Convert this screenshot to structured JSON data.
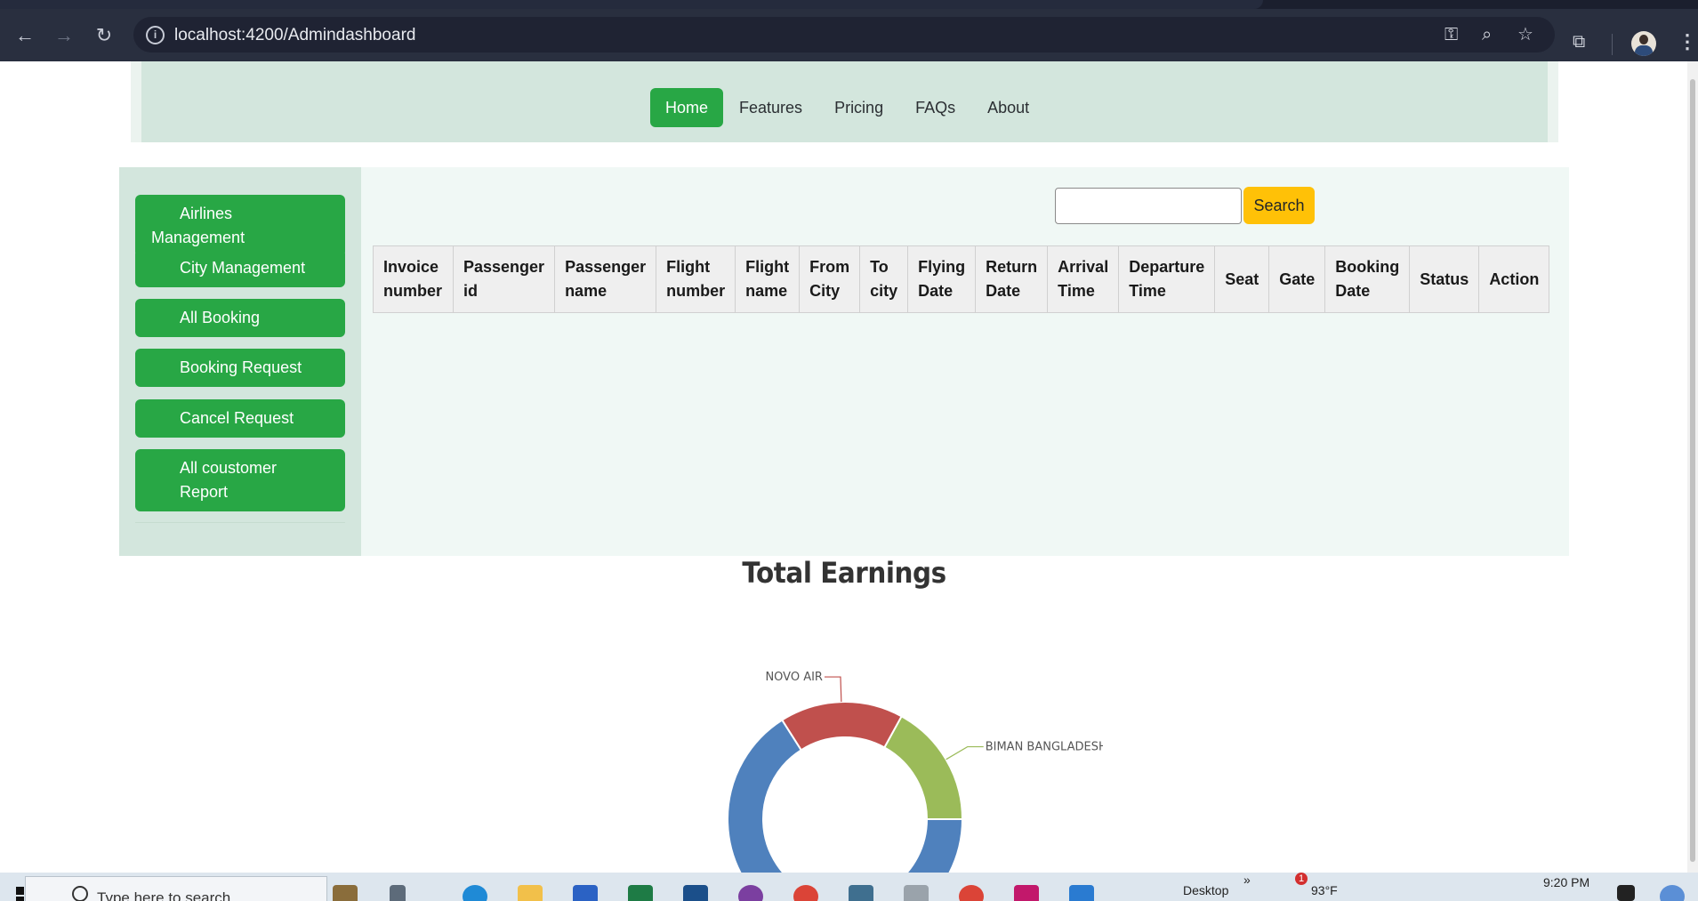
{
  "browser": {
    "url": "localhost:4200/Admindashboard"
  },
  "topnav": {
    "items": [
      "Home",
      "Features",
      "Pricing",
      "FAQs",
      "About"
    ],
    "active": "Home"
  },
  "sidebar": {
    "items": [
      "Airlines Management",
      "City Management",
      "All Booking",
      "Booking Request",
      "Cancel Request",
      "All coustomer Report"
    ]
  },
  "search": {
    "placeholder": "",
    "button_label": "Search"
  },
  "table": {
    "columns": [
      [
        "Invoice",
        "number"
      ],
      [
        "Passenger",
        "id"
      ],
      [
        "Passenger",
        "name"
      ],
      [
        "Flight",
        "number"
      ],
      [
        "Flight",
        "name"
      ],
      [
        "From",
        "City"
      ],
      [
        "To",
        "city"
      ],
      [
        "Flying",
        "Date"
      ],
      [
        "Return",
        "Date"
      ],
      [
        "Arrival",
        "Time"
      ],
      [
        "Departure",
        "Time"
      ],
      [
        "Seat"
      ],
      [
        "Gate"
      ],
      [
        "Booking",
        "Date"
      ],
      [
        "Status"
      ],
      [
        "Action"
      ]
    ],
    "rows": []
  },
  "chart_data": {
    "type": "pie",
    "subtype": "doughnut",
    "title": "Total Earnings",
    "slices": [
      {
        "label": "BIMAN BANGLADESH",
        "percent": 17,
        "color": "#9bbb59"
      },
      {
        "label": "",
        "percent": 66,
        "color": "#4f81bd"
      },
      {
        "label": "NOVO AIR",
        "percent": 17,
        "color": "#c0504d"
      }
    ],
    "start_angle_deg": 0
  },
  "taskbar": {
    "search_placeholder": "Type here to search",
    "desktop_label": "Desktop",
    "temperature": "93°F",
    "time": "9:20 PM",
    "notification_count": "1"
  },
  "colors": {
    "primary_green": "#28a745",
    "search_yellow": "#ffc107",
    "nav_bg": "#d3e6dd",
    "content_bg": "#f0f8f5"
  }
}
